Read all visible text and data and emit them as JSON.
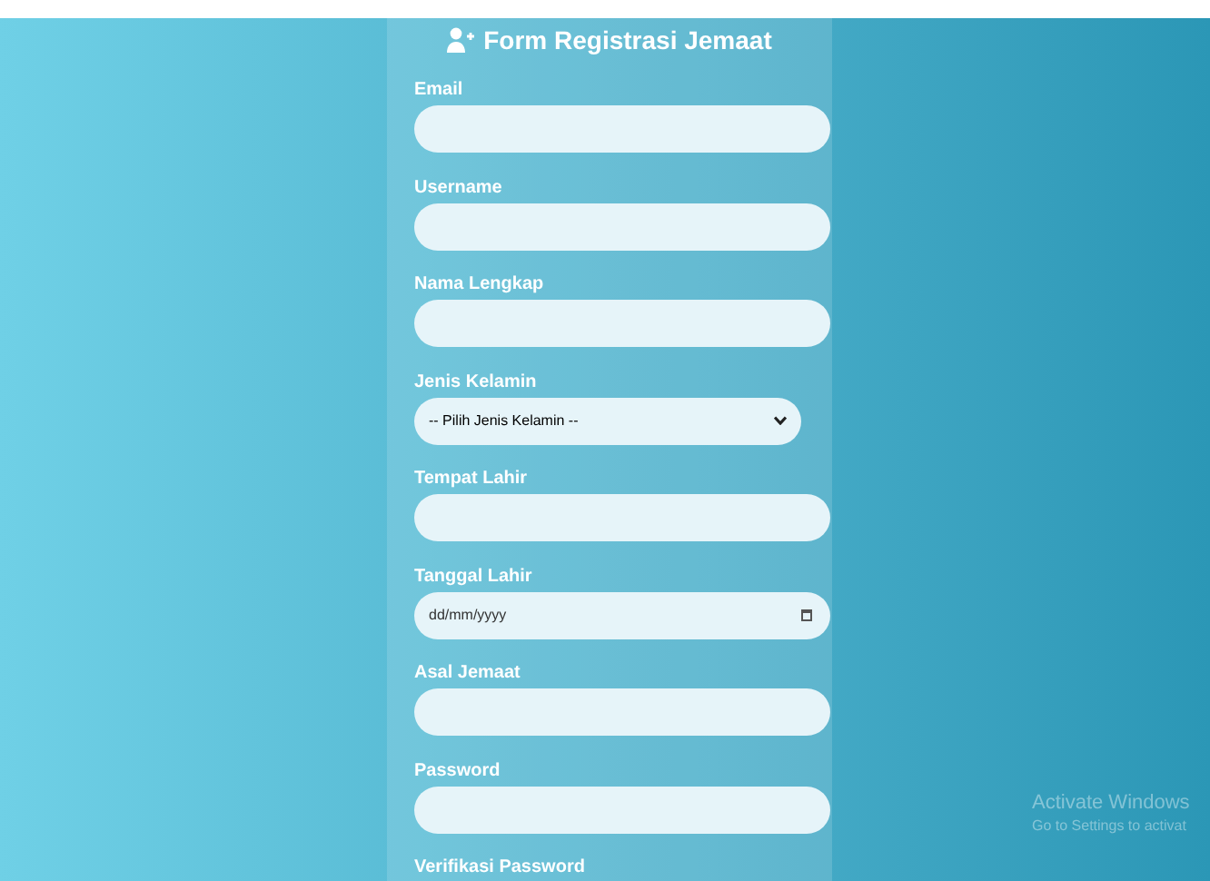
{
  "form": {
    "title": "Form Registrasi Jemaat",
    "fields": [
      {
        "kind": "text",
        "label": "Email"
      },
      {
        "kind": "text",
        "label": "Username"
      },
      {
        "kind": "text",
        "label": "Nama Lengkap"
      },
      {
        "kind": "select",
        "label": "Jenis Kelamin",
        "value": "-- Pilih Jenis Kelamin --"
      },
      {
        "kind": "text",
        "label": "Tempat Lahir"
      },
      {
        "kind": "date",
        "label": "Tanggal Lahir",
        "placeholder": "dd/mm/yyyy"
      },
      {
        "kind": "text",
        "label": "Asal Jemaat"
      },
      {
        "kind": "password",
        "label": "Password"
      },
      {
        "kind": "label",
        "label": "Verifikasi Password"
      }
    ]
  },
  "os_notice": {
    "title": "Activate Windows",
    "subtitle": "Go to Settings to activat"
  }
}
